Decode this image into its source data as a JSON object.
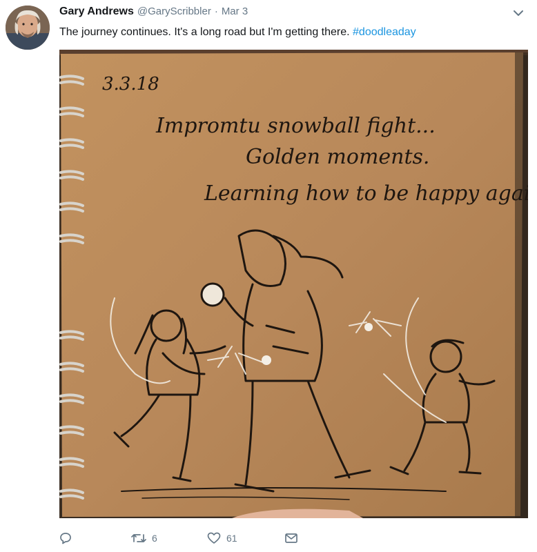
{
  "tweet": {
    "display_name": "Gary Andrews",
    "handle": "@GaryScribbler",
    "separator": "·",
    "date": "Mar 3",
    "text": "The journey continues. It's a long road but I'm getting there. ",
    "hashtag": "#doodleaday",
    "media": {
      "note_date": "3.3.18",
      "note_line1": "Impromtu snowball fight...",
      "note_line2": "Golden moments.",
      "note_line3": "Learning how to be happy again."
    }
  },
  "actions": {
    "reply_count": "",
    "retweet_count": "6",
    "like_count": "61"
  },
  "icons": {
    "menu": "chevron-down-icon",
    "reply": "reply-icon",
    "retweet": "retweet-icon",
    "like": "heart-icon",
    "dm": "envelope-icon"
  },
  "colors": {
    "text": "#14171a",
    "secondary": "#657786",
    "link": "#1b95e0",
    "paper": "#b8895a"
  }
}
